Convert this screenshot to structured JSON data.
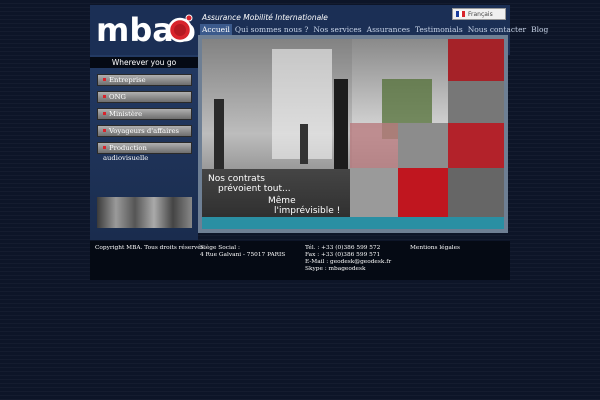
{
  "header": {
    "logo_text": "mbao",
    "tagline": "Assurance Mobilité Internationale",
    "language": "Français"
  },
  "nav": {
    "items": [
      {
        "label": "Accueil",
        "active": true
      },
      {
        "label": "Qui sommes nous ?",
        "active": false
      },
      {
        "label": "Nos services",
        "active": false
      },
      {
        "label": "Assurances",
        "active": false
      },
      {
        "label": "Testimonials",
        "active": false
      },
      {
        "label": "Nous contacter",
        "active": false
      },
      {
        "label": "Blog",
        "active": false
      }
    ]
  },
  "sidebar": {
    "title": "Wherever you go",
    "items": [
      "Entreprise",
      "ONG",
      "Ministère",
      "Voyageurs d'affaires",
      "Production audiovisuelle"
    ]
  },
  "hero": {
    "line1": "Nos contrats",
    "line2": "prévoient tout...",
    "line3": "Même",
    "line4": "l'imprévisible !"
  },
  "footer": {
    "copyright": "Copyright MBA. Tous droits réservés.",
    "siege_label": "Siège Social :",
    "siege_address": "4 Rue Galvani - 75017 PARIS",
    "tel": "Tél. : +33 (0)386 599 572",
    "fax": "Fax : +33 (0)386 599 571",
    "email": "E-Mail : geodesk@geodesk.fr",
    "skype": "Skype : mbageodesk",
    "legal": "Mentions légales"
  },
  "colors": {
    "accent_red": "#d8242c",
    "nav_active": "#3b5a8c",
    "header_bg": "#1b2f55"
  }
}
